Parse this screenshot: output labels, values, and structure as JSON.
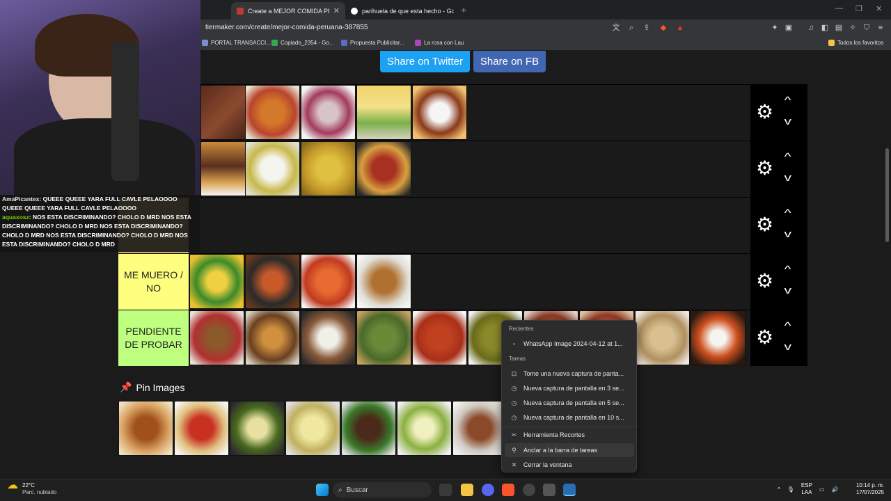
{
  "browser": {
    "tabs": [
      {
        "title": "Create a MEJOR COMIDA PERUA"
      },
      {
        "title": "parihuela de que esta hecho - Googl"
      }
    ],
    "url": "tiermaker.com/create/mejor-comida-peruana-387855",
    "bookmarks": [
      "PORTAL TRANSACCI...",
      "Copiado_2354 - Go...",
      "Propuesta Publicitar...",
      "La rosa con Lau"
    ],
    "all_bookmarks": "Todos los favoritos"
  },
  "page": {
    "share_twitter": "Share on Twitter",
    "share_fb": "Share on FB",
    "tiers": [
      {
        "label": "",
        "color": "#1a1a1a"
      },
      {
        "label": "",
        "color": "#1a1a1a"
      },
      {
        "label": "",
        "color": "#c8b46a"
      },
      {
        "label": "ME MUERO / NO",
        "color": "#ffff7f"
      },
      {
        "label": "PENDIENTE DE PROBAR",
        "color": "#bfff7f"
      }
    ],
    "pin_images": "Pin Images"
  },
  "chat": {
    "line1_user": "AmaPicantex",
    "line1_msg": ": QUEEE QUEEE YARA FULL CAVLE PELAOOOO QUEEE QUEEE YARA FULL CAVLE PELAOOOO",
    "line2_user": "aquaxosz",
    "line2_msg": ": NOS ESTA DISCRIMINANDO? CHOLO D MRD NOS ESTA DISCRIMINANDO? CHOLO D MRD NOS ESTA DISCRIMINANDO? CHOLO D MRD NOS ESTA DISCRIMINANDO? CHOLO D MRD NOS ESTA DISCRIMINANDO? CHOLO D MRD"
  },
  "context_menu": {
    "recent_header": "Recientes",
    "recent_item": "WhatsApp Image 2024-04-12 at 1...",
    "tasks_header": "Tareas",
    "tasks": [
      "Tome una nueva captura de panta...",
      "Nueva captura de pantalla en 3 se...",
      "Nueva captura de pantalla en 5 se...",
      "Nueva captura de pantalla en 10 s..."
    ],
    "app_name": "Herramienta Recortes",
    "pin_taskbar": "Anclar a la barra de tareas",
    "close_window": "Cerrar la ventana"
  },
  "taskbar": {
    "temperature": "22°C",
    "weather": "Parc. nublado",
    "search": "Buscar",
    "lang1": "ESP",
    "lang2": "LAA",
    "time": "10:14 p. m.",
    "date": "17/07/2025"
  }
}
